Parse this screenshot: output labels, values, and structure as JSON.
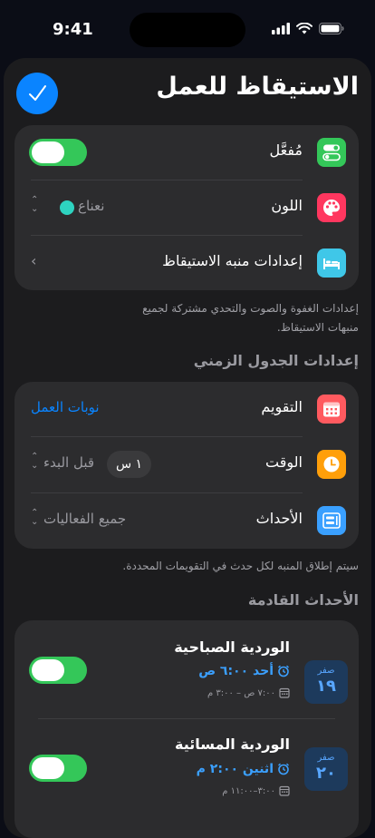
{
  "status": {
    "time": "9:41"
  },
  "header": {
    "title": "الاستيقاظ للعمل"
  },
  "settings": {
    "enabled_label": "مُفعَّل",
    "color_label": "اللون",
    "color_value": "نعناع",
    "color_swatch": "#2ed3c0",
    "alarm_settings_label": "إعدادات منبه الاستيقاظ",
    "footer_line1": "إعدادات الغفوة والصوت والتحدي مشتركة لجميع",
    "footer_line2": "منبهات الاستيقاظ."
  },
  "schedule": {
    "section_title": "إعدادات الجدول الزمني",
    "calendar_label": "التقويم",
    "calendar_value": "نوبات العمل",
    "time_label": "الوقت",
    "time_pill": "١ س",
    "time_value": "قبل البدء",
    "events_label": "الأحداث",
    "events_value": "جميع الفعاليات",
    "footer": "سيتم إطلاق المنبه لكل حدث في التقويمات المحددة."
  },
  "upcoming": {
    "section_title": "الأحداث القادمة",
    "events": [
      {
        "month": "صفر",
        "day": "١٩",
        "title": "الوردية الصباحية",
        "alarm_time": "أحد ٦:٠٠ ص",
        "range": "٧:٠٠ ص – ٣:٠٠ م"
      },
      {
        "month": "صفر",
        "day": "٢٠",
        "title": "الوردية المسائية",
        "alarm_time": "اثنين ٢:٠٠ م",
        "range": "٣:٠٠–١١:٠٠ م"
      }
    ]
  },
  "colors": {
    "accent": "#0a84ff",
    "toggle_on": "#34c759",
    "card": "#2c2c2e"
  }
}
